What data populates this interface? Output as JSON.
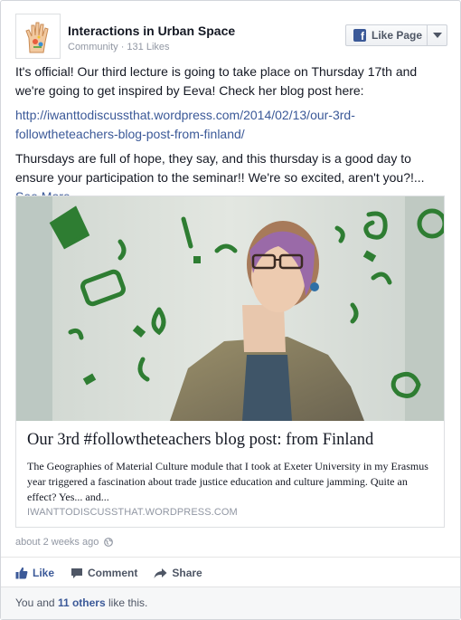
{
  "page": {
    "name": "Interactions in Urban Space",
    "category": "Community",
    "likes": "131 Likes",
    "like_button": "Like Page"
  },
  "post": {
    "paragraph1": "It's official! Our third lecture is going to take place on Thursday 17th and we're going to get inspired by Eeva! Check her blog post here:",
    "link": "http://iwanttodiscussthat.wordpress.com/2014/02/13/our-3rd-followtheteachers-blog-post-from-finland/",
    "paragraph2": "Thursdays are full of hope, they say, and this thursday is a good day to ensure your participation to the seminar!! We're so excited, aren't you?!...",
    "see_more": "See More"
  },
  "attachment": {
    "title": "Our 3rd #followtheteachers blog post: from Finland",
    "description": "The Geographies of Material Culture module that I took at Exeter University in my Erasmus year triggered a fascination about trade justice education and culture jamming. Quite an effect? Yes... and...",
    "domain": "IWANTTODISCUSSTHAT.WORDPRESS.COM"
  },
  "timestamp": "about 2 weeks ago",
  "actions": {
    "like": "Like",
    "comment": "Comment",
    "share": "Share"
  },
  "likes_summary": {
    "prefix": "You and",
    "others": "11 others",
    "suffix": "like this."
  },
  "colors": {
    "link_blue": "#3b5998",
    "doodle_green": "#2e7d32"
  }
}
